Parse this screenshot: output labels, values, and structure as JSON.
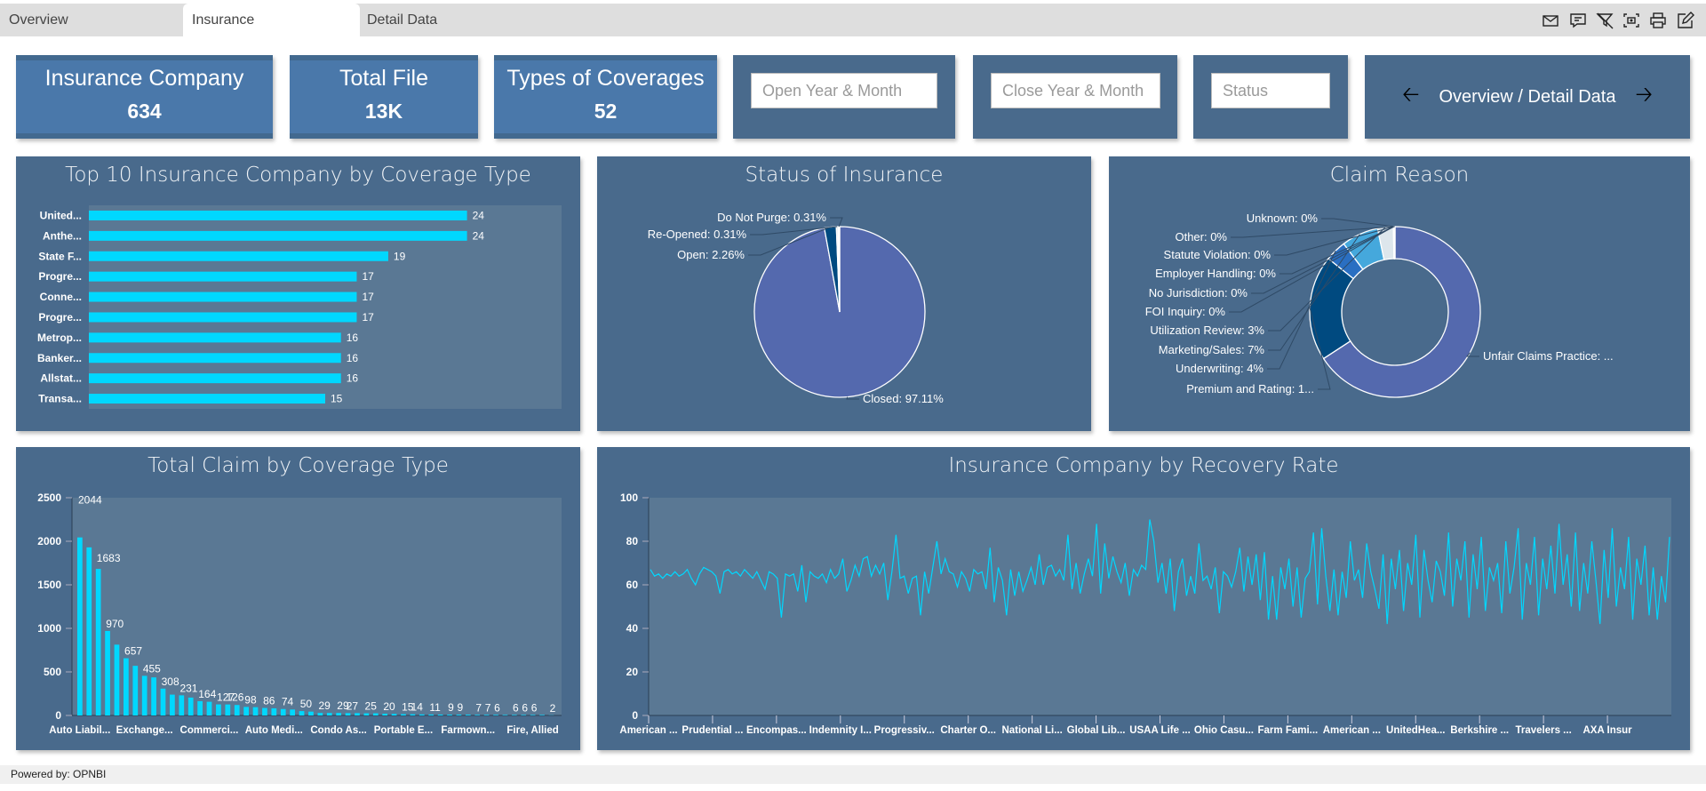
{
  "tabs": [
    {
      "label": "Overview",
      "active": false
    },
    {
      "label": "Insurance",
      "active": true
    },
    {
      "label": "Detail Data",
      "active": false
    }
  ],
  "toolbar": [
    "envelope-icon",
    "comment-icon",
    "filter-off-icon",
    "screenshot-icon",
    "print-icon",
    "edit-icon"
  ],
  "kpis": [
    {
      "title": "Insurance Company",
      "value": "634"
    },
    {
      "title": "Total File",
      "value": "13K"
    },
    {
      "title": "Types of Coverages",
      "value": "52"
    }
  ],
  "filters": {
    "open": "Open Year & Month",
    "close": "Close Year & Month",
    "status": "Status"
  },
  "nav": {
    "label": "Overview / Detail Data",
    "prev_icon": "arrow-left-icon",
    "next_icon": "arrow-right-icon"
  },
  "colors": {
    "bar": "#00d8ff",
    "panel": "#496a8c",
    "plot": "#5a7894",
    "kpi": "#4a78aa"
  },
  "chart_data": [
    {
      "type": "bar",
      "orientation": "horizontal",
      "title": "Top 10 Insurance Company by Coverage Type",
      "categories": [
        "United...",
        "Anthe...",
        "State F...",
        "Progre...",
        "Conne...",
        "Progre...",
        "Metrop...",
        "Banker...",
        "Allstat...",
        "Transa..."
      ],
      "values": [
        24,
        24,
        19,
        17,
        17,
        17,
        16,
        16,
        16,
        15
      ],
      "xlim": [
        0,
        30
      ],
      "data_labels": true
    },
    {
      "type": "pie",
      "title": "Status of Insurance",
      "slices": [
        {
          "label": "Closed: 97.11%",
          "value": 97.11,
          "color": "#5469ae"
        },
        {
          "label": "Open: 2.26%",
          "value": 2.26,
          "color": "#004a80"
        },
        {
          "label": "Re-Opened: 0.31%",
          "value": 0.31,
          "color": "#cfe0ee"
        },
        {
          "label": "Do Not Purge: 0.31%",
          "value": 0.31,
          "color": "#ffffff"
        }
      ]
    },
    {
      "type": "pie",
      "subtype": "donut",
      "title": "Claim Reason",
      "slices": [
        {
          "label": "Unfair Claims Practice: ...",
          "value": 66,
          "color": "#5469ae"
        },
        {
          "label": "Premium and Rating: 1...",
          "value": 20,
          "color": "#004a80"
        },
        {
          "label": "Underwriting: 4%",
          "value": 4,
          "color": "#2a6fc2"
        },
        {
          "label": "Marketing/Sales: 7%",
          "value": 7,
          "color": "#45a8dc"
        },
        {
          "label": "Utilization Review: 3%",
          "value": 3,
          "color": "#dde6ec"
        },
        {
          "label": "FOI Inquiry: 0%",
          "value": 0.05,
          "color": "#ffffff"
        },
        {
          "label": "No Jurisdiction: 0%",
          "value": 0.05,
          "color": "#ffffff"
        },
        {
          "label": "Employer Handling: 0%",
          "value": 0.05,
          "color": "#ffffff"
        },
        {
          "label": "Statute Violation: 0%",
          "value": 0.05,
          "color": "#ffffff"
        },
        {
          "label": "Other: 0%",
          "value": 0.05,
          "color": "#ffffff"
        },
        {
          "label": "Unknown: 0%",
          "value": 0.05,
          "color": "#ffffff"
        }
      ]
    },
    {
      "type": "bar",
      "title": "Total Claim by Coverage Type",
      "ylim": [
        0,
        2500
      ],
      "yticks": [
        0,
        500,
        1000,
        1500,
        2000,
        2500
      ],
      "values": [
        2044,
        1930,
        1683,
        970,
        813,
        657,
        570,
        455,
        437,
        308,
        239,
        231,
        205,
        164,
        157,
        127,
        126,
        120,
        98,
        95,
        86,
        82,
        74,
        68,
        50,
        44,
        29,
        29,
        29,
        27,
        27,
        25,
        25,
        20,
        18,
        15,
        14,
        12,
        11,
        10,
        9,
        9,
        9,
        7,
        7,
        7,
        6,
        6,
        6,
        6,
        6,
        2
      ],
      "data_labels": [
        "2044",
        "",
        "1683",
        "970",
        "",
        "657",
        "",
        "455",
        "",
        "308",
        "",
        "231",
        "",
        "164",
        "",
        "127",
        "126",
        "",
        "98",
        "",
        "86",
        "",
        "74",
        "",
        "50",
        "",
        "29",
        "",
        "29",
        "27",
        "",
        "25",
        "",
        "20",
        "",
        "15",
        "14",
        "",
        "11",
        "",
        "9",
        "9",
        "",
        "7",
        "7",
        "6",
        "",
        "6",
        "6",
        "6",
        "",
        "2"
      ],
      "x_tick_labels": [
        {
          "index": 0,
          "label": "Auto Liabil..."
        },
        {
          "index": 7,
          "label": "Exchange..."
        },
        {
          "index": 14,
          "label": "Commerci..."
        },
        {
          "index": 21,
          "label": "Auto Medi..."
        },
        {
          "index": 28,
          "label": "Condo As..."
        },
        {
          "index": 35,
          "label": "Portable E..."
        },
        {
          "index": 42,
          "label": "Farmown..."
        },
        {
          "index": 49,
          "label": "Fire, Allied"
        }
      ]
    },
    {
      "type": "line",
      "title": "Insurance Company by Recovery Rate",
      "ylim": [
        0,
        100
      ],
      "yticks": [
        0,
        20,
        40,
        60,
        80,
        100
      ],
      "x_tick_labels": [
        "American ...",
        "Prudential ...",
        "Encompas...",
        "Indemnity I...",
        "Progressiv...",
        "Charter O...",
        "National Li...",
        "Global Lib...",
        "USAA Life ...",
        "Ohio Casu...",
        "Farm Fami...",
        "American ...",
        "UnitedHea...",
        "Berkshire ...",
        "Travelers ...",
        "AXA Insur"
      ],
      "values": [
        67,
        64,
        65,
        63,
        65,
        64,
        66,
        64,
        65,
        67,
        63,
        60,
        65,
        68,
        67,
        66,
        64,
        56,
        66,
        67,
        65,
        66,
        64,
        67,
        65,
        63,
        66,
        62,
        58,
        66,
        65,
        63,
        45,
        65,
        64,
        65,
        57,
        69,
        52,
        66,
        64,
        63,
        65,
        61,
        67,
        63,
        65,
        72,
        57,
        62,
        69,
        64,
        72,
        73,
        64,
        69,
        65,
        70,
        53,
        66,
        83,
        63,
        64,
        56,
        63,
        64,
        46,
        66,
        56,
        68,
        80,
        65,
        72,
        66,
        65,
        59,
        66,
        63,
        57,
        67,
        65,
        66,
        58,
        77,
        52,
        68,
        62,
        46,
        67,
        55,
        66,
        57,
        62,
        68,
        60,
        74,
        60,
        68,
        69,
        64,
        67,
        62,
        83,
        58,
        70,
        56,
        65,
        72,
        64,
        88,
        56,
        79,
        63,
        73,
        66,
        61,
        70,
        55,
        67,
        64,
        69,
        67,
        90,
        80,
        61,
        70,
        56,
        72,
        48,
        66,
        72,
        55,
        64,
        56,
        79,
        62,
        64,
        58,
        68,
        47,
        66,
        64,
        59,
        66,
        77,
        57,
        73,
        60,
        74,
        53,
        75,
        44,
        64,
        44,
        68,
        58,
        72,
        50,
        68,
        45,
        63,
        66,
        84,
        51,
        86,
        64,
        48,
        67,
        46,
        66,
        54,
        80,
        62,
        67,
        54,
        79,
        66,
        58,
        49,
        74,
        42,
        72,
        58,
        76,
        48,
        70,
        60,
        83,
        45,
        76,
        62,
        52,
        71,
        66,
        55,
        84,
        50,
        72,
        62,
        80,
        45,
        74,
        58,
        82,
        48,
        68,
        62,
        70,
        47,
        80,
        56,
        68,
        86,
        44,
        70,
        60,
        82,
        46,
        72,
        58,
        78,
        56,
        88,
        60,
        74,
        50,
        84,
        48,
        70,
        56,
        80,
        62,
        42,
        76,
        54,
        86,
        50,
        68,
        58,
        82,
        44,
        72,
        60,
        78,
        46,
        68,
        44,
        64,
        52,
        82
      ]
    }
  ],
  "footer": "Powered by: OPNBI"
}
